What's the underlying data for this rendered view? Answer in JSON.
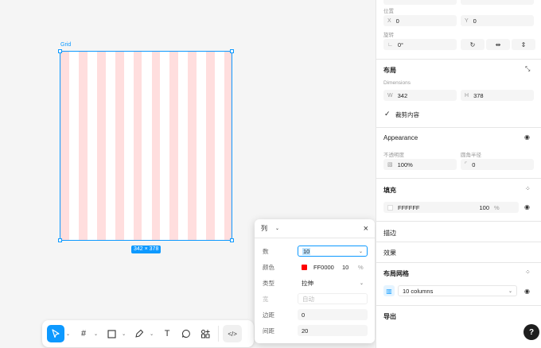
{
  "canvas": {
    "frame_label": "Grid",
    "size_badge": "342 × 378"
  },
  "toolbar": {
    "icons": [
      "pointer-icon",
      "frame-icon",
      "rectangle-icon",
      "pen-icon",
      "text-icon",
      "comment-icon",
      "components-icon",
      "code-icon"
    ],
    "text_glyph": "T",
    "code_glyph": "</>"
  },
  "popup": {
    "type_select": "列",
    "close": "×",
    "rows": {
      "count_label": "数",
      "count_value": "10",
      "color_label": "颜色",
      "color_hex": "FF0000",
      "color_opacity": "10",
      "color_unit": "%",
      "type_label": "类型",
      "type_value": "拉伸",
      "width_label": "宽",
      "width_placeholder": "自动",
      "margin_label": "边距",
      "margin_value": "0",
      "gutter_label": "间距",
      "gutter_value": "20"
    }
  },
  "panel": {
    "position_label": "位置",
    "x_label": "X",
    "x_value": "0",
    "y_label": "Y",
    "y_value": "0",
    "rotation_label": "旋转",
    "rotation_value": "0°",
    "layout_title": "布局",
    "dimensions_label": "Dimensions",
    "w_label": "W",
    "w_value": "342",
    "h_label": "H",
    "h_value": "378",
    "clip_label": "裁剪内容",
    "appearance_title": "Appearance",
    "opacity_label": "不透明度",
    "opacity_value": "100%",
    "radius_label": "圆角半径",
    "radius_value": "0",
    "fill_title": "填充",
    "fill_hex": "FFFFFF",
    "fill_opacity": "100",
    "fill_unit": "%",
    "stroke_title": "描边",
    "effects_title": "效果",
    "layout_grid_title": "布局网格",
    "grid_value": "10 columns",
    "export_title": "导出",
    "help": "?"
  },
  "colors": {
    "accent": "#0d99ff",
    "grid_column": "#ffdede",
    "grid_red": "#FF0000"
  }
}
